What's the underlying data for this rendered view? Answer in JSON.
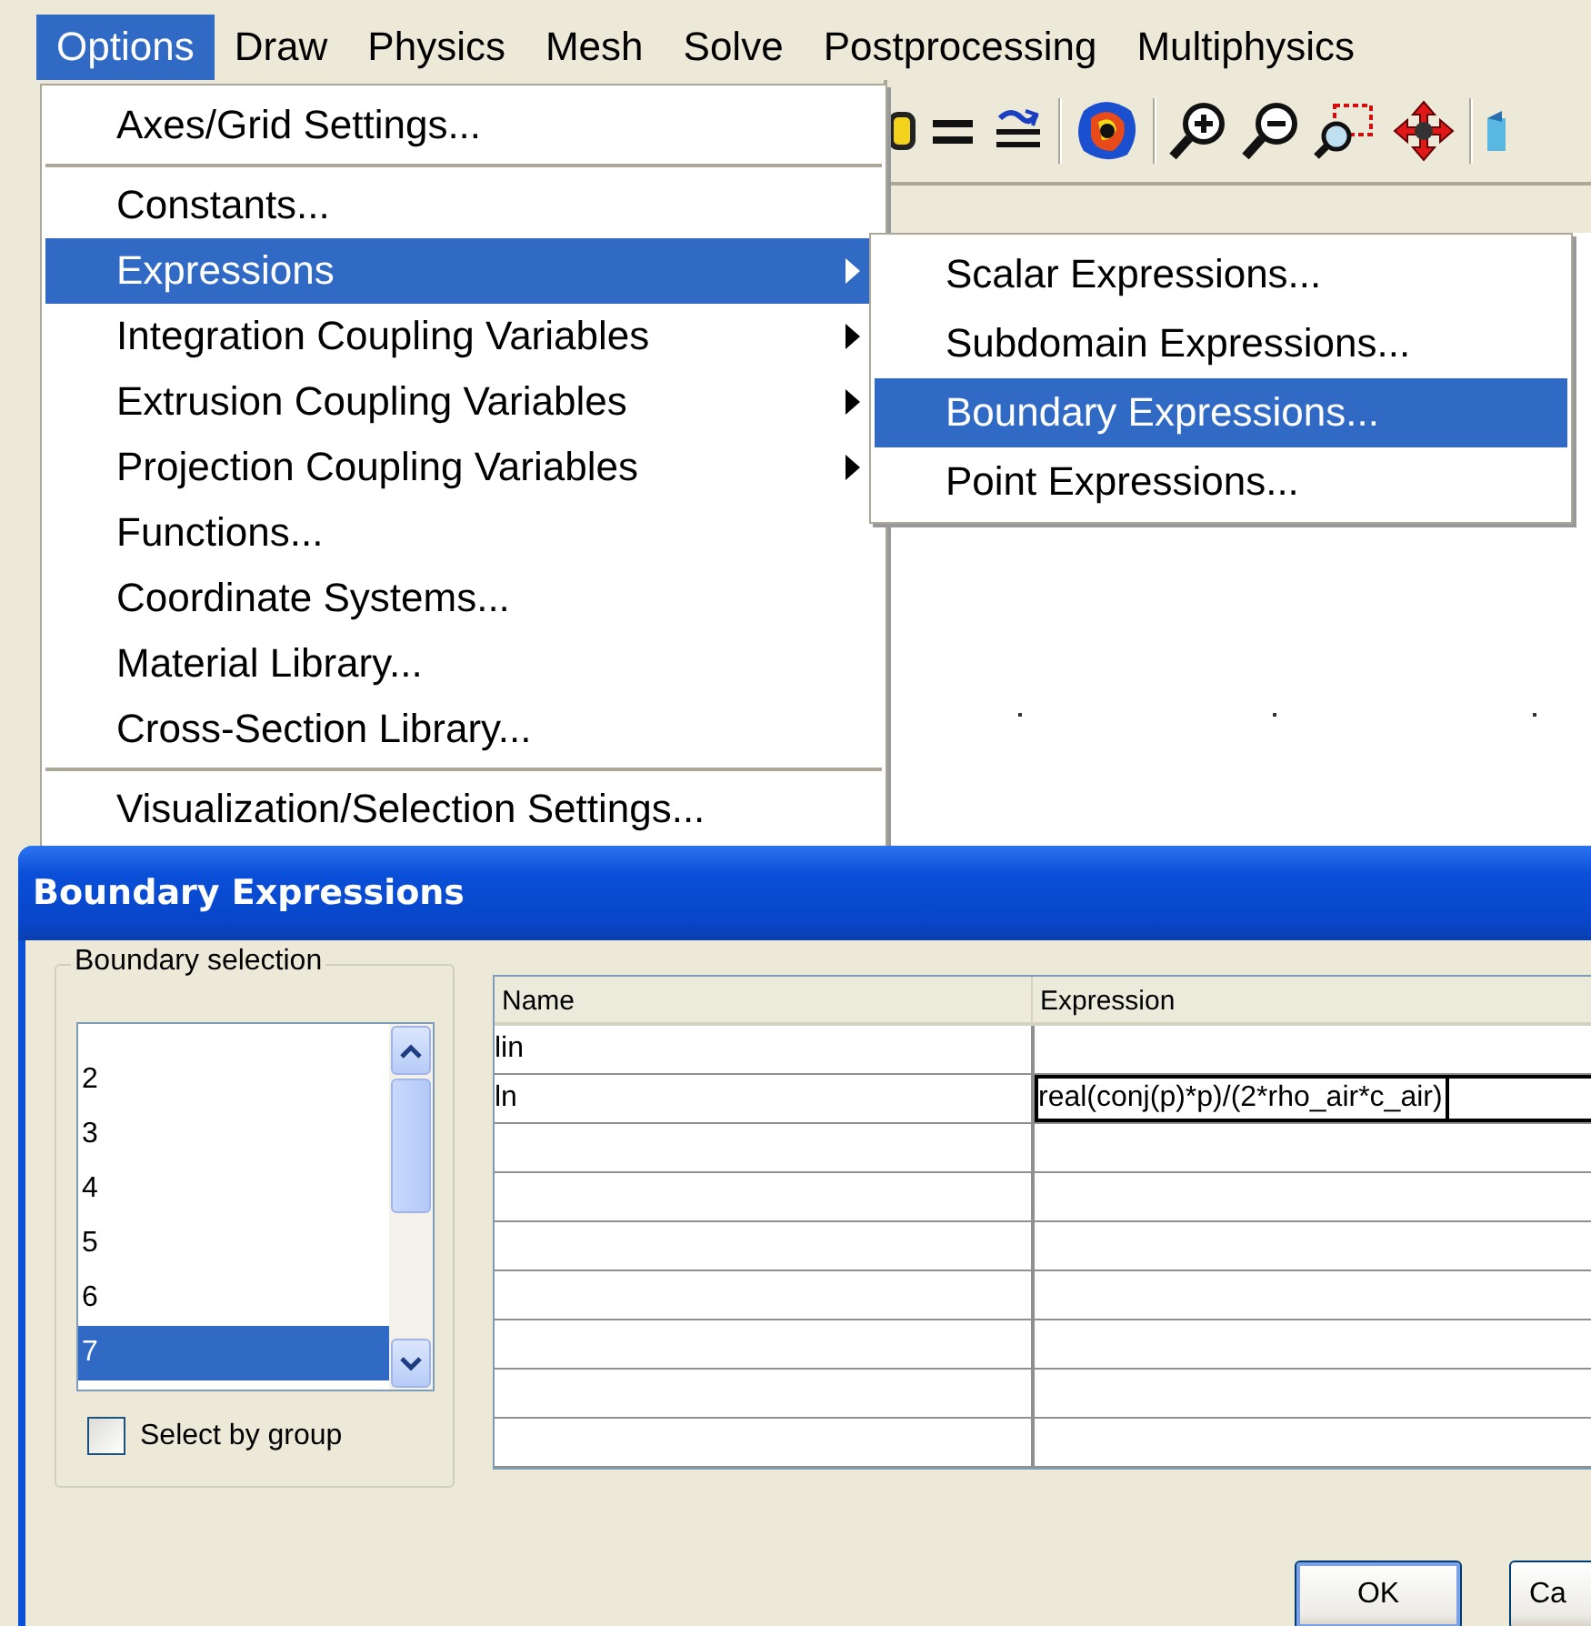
{
  "menubar": [
    {
      "label": "Options",
      "selected": true
    },
    {
      "label": "Draw",
      "selected": false
    },
    {
      "label": "Physics",
      "selected": false
    },
    {
      "label": "Mesh",
      "selected": false
    },
    {
      "label": "Solve",
      "selected": false
    },
    {
      "label": "Postprocessing",
      "selected": false
    },
    {
      "label": "Multiphysics",
      "selected": false
    }
  ],
  "options_menu": {
    "items": [
      {
        "label": "Axes/Grid Settings...",
        "selected": false,
        "submenu": false,
        "separator_after": true
      },
      {
        "label": "Constants...",
        "selected": false,
        "submenu": false,
        "separator_after": false
      },
      {
        "label": "Expressions",
        "selected": true,
        "submenu": true,
        "separator_after": false
      },
      {
        "label": "Integration Coupling Variables",
        "selected": false,
        "submenu": true,
        "separator_after": false
      },
      {
        "label": "Extrusion Coupling Variables",
        "selected": false,
        "submenu": true,
        "separator_after": false
      },
      {
        "label": "Projection Coupling Variables",
        "selected": false,
        "submenu": true,
        "separator_after": false
      },
      {
        "label": "Functions...",
        "selected": false,
        "submenu": false,
        "separator_after": false
      },
      {
        "label": "Coordinate Systems...",
        "selected": false,
        "submenu": false,
        "separator_after": false
      },
      {
        "label": "Material Library...",
        "selected": false,
        "submenu": false,
        "separator_after": false
      },
      {
        "label": "Cross-Section Library...",
        "selected": false,
        "submenu": false,
        "separator_after": true
      },
      {
        "label": "Visualization/Selection Settings...",
        "selected": false,
        "submenu": false,
        "separator_after": false
      }
    ]
  },
  "expressions_submenu": {
    "items": [
      {
        "label": "Scalar Expressions...",
        "selected": false
      },
      {
        "label": "Subdomain Expressions...",
        "selected": false
      },
      {
        "label": "Boundary Expressions...",
        "selected": true
      },
      {
        "label": "Point Expressions...",
        "selected": false
      }
    ]
  },
  "dialog": {
    "title": "Boundary Expressions",
    "boundary_selection": {
      "label": "Boundary selection",
      "items": [
        {
          "label": "2",
          "selected": false
        },
        {
          "label": "3",
          "selected": false
        },
        {
          "label": "4",
          "selected": false
        },
        {
          "label": "5",
          "selected": false
        },
        {
          "label": "6",
          "selected": false
        },
        {
          "label": "7",
          "selected": true
        }
      ],
      "select_by_group": {
        "label": "Select by group",
        "checked": false
      }
    },
    "table": {
      "columns": [
        "Name",
        "Expression"
      ],
      "rows": [
        {
          "name": "lin",
          "editing": false
        },
        {
          "name": "ln",
          "expression": "real(conj(p)*p)/(2*rho_air*c_air)",
          "editing": true
        }
      ]
    },
    "buttons": [
      {
        "label": "OK",
        "default": true
      },
      {
        "label": "Ca",
        "default": false
      }
    ]
  }
}
